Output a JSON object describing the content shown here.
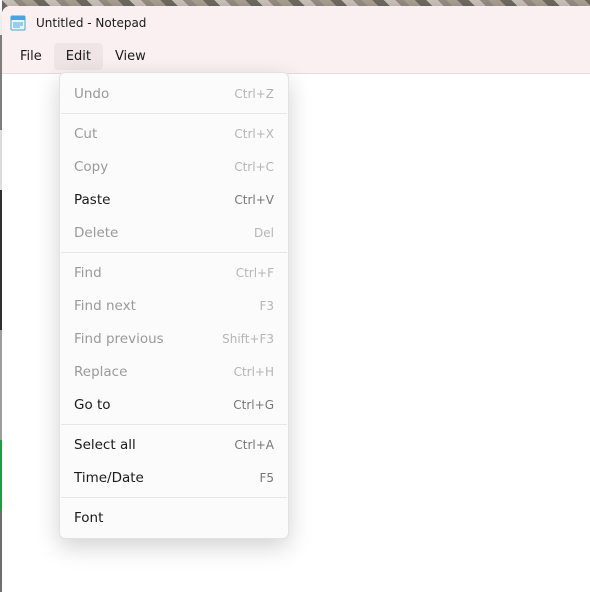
{
  "window": {
    "title": "Untitled - Notepad"
  },
  "menubar": {
    "file": "File",
    "edit": "Edit",
    "view": "View",
    "activeIndex": 1
  },
  "editMenu": {
    "groups": [
      [
        {
          "label": "Undo",
          "shortcut": "Ctrl+Z",
          "enabled": false
        }
      ],
      [
        {
          "label": "Cut",
          "shortcut": "Ctrl+X",
          "enabled": false
        },
        {
          "label": "Copy",
          "shortcut": "Ctrl+C",
          "enabled": false
        },
        {
          "label": "Paste",
          "shortcut": "Ctrl+V",
          "enabled": true
        },
        {
          "label": "Delete",
          "shortcut": "Del",
          "enabled": false
        }
      ],
      [
        {
          "label": "Find",
          "shortcut": "Ctrl+F",
          "enabled": false
        },
        {
          "label": "Find next",
          "shortcut": "F3",
          "enabled": false
        },
        {
          "label": "Find previous",
          "shortcut": "Shift+F3",
          "enabled": false
        },
        {
          "label": "Replace",
          "shortcut": "Ctrl+H",
          "enabled": false
        },
        {
          "label": "Go to",
          "shortcut": "Ctrl+G",
          "enabled": true
        }
      ],
      [
        {
          "label": "Select all",
          "shortcut": "Ctrl+A",
          "enabled": true
        },
        {
          "label": "Time/Date",
          "shortcut": "F5",
          "enabled": true
        }
      ],
      [
        {
          "label": "Font",
          "shortcut": "",
          "enabled": true
        }
      ]
    ]
  }
}
